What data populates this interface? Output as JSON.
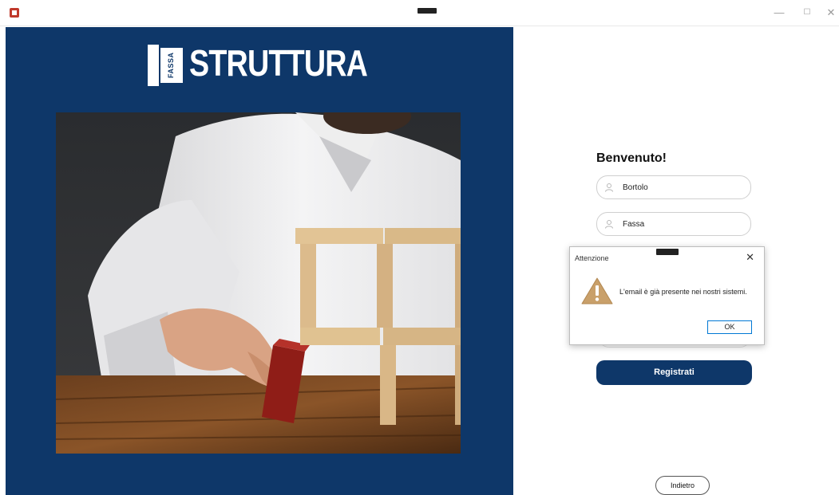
{
  "window": {
    "minimize_glyph": "—",
    "maximize_glyph": "☐",
    "close_glyph": "✕"
  },
  "brand": {
    "logo_small": "FASSA",
    "logo_text": "STRUTTURA",
    "panel_color": "#0e3769"
  },
  "form": {
    "welcome": "Benvenuto!",
    "first_name_value": "Bortolo",
    "last_name_value": "Fassa",
    "register_label": "Registrati",
    "back_label": "Indietro",
    "field_icon": "user-icon"
  },
  "dialog": {
    "title": "Attenzione",
    "message": "L'email è già presente nei nostri sistemi.",
    "ok_label": "OK",
    "icon": "warning-icon",
    "close_glyph": "✕"
  }
}
